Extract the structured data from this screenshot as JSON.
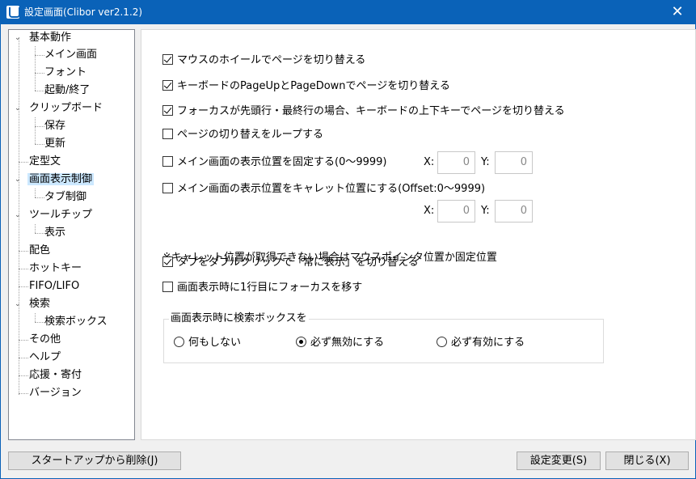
{
  "window": {
    "title": "設定画面(Clibor ver2.1.2)",
    "close_glyph": "✕"
  },
  "tree": {
    "expander": "⌄",
    "items": [
      {
        "label": "基本動作"
      },
      {
        "label": "メイン画面"
      },
      {
        "label": "フォント"
      },
      {
        "label": "起動/終了"
      },
      {
        "label": "クリップボード"
      },
      {
        "label": "保存"
      },
      {
        "label": "更新"
      },
      {
        "label": "定型文"
      },
      {
        "label": "画面表示制御"
      },
      {
        "label": "タブ制御"
      },
      {
        "label": "ツールチップ"
      },
      {
        "label": "表示"
      },
      {
        "label": "配色"
      },
      {
        "label": "ホットキー"
      },
      {
        "label": "FIFO/LIFO"
      },
      {
        "label": "検索"
      },
      {
        "label": "検索ボックス"
      },
      {
        "label": "その他"
      },
      {
        "label": "ヘルプ"
      },
      {
        "label": "応援・寄付"
      },
      {
        "label": "バージョン"
      }
    ]
  },
  "options": [
    {
      "label": "マウスのホイールでページを切り替える",
      "checked": true
    },
    {
      "label": "キーボードのPageUpとPageDownでページを切り替える",
      "checked": true
    },
    {
      "label": "フォーカスが先頭行・最終行の場合、キーボードの上下キーでページを切り替える",
      "checked": true
    },
    {
      "label": "ページの切り替えをループする",
      "checked": false
    },
    {
      "label": "メイン画面の表示位置を固定する(0～9999)",
      "checked": false
    },
    {
      "label": "メイン画面の表示位置をキャレット位置にする(Offset:0～9999)",
      "checked": false
    },
    {
      "label": "タブをダブルクリックで「常に表示」を切り替える",
      "checked": true
    },
    {
      "label": "画面表示時に1行目にフォーカスを移す",
      "checked": false
    }
  ],
  "fixed_position": {
    "x_label": "X:",
    "x_value": "0",
    "y_label": "Y:",
    "y_value": "0"
  },
  "caret_offset": {
    "x_label": "X:",
    "x_value": "0",
    "y_label": "Y:",
    "y_value": "0"
  },
  "note": "※キャレット位置が取得できない場合はマウスポインタ位置か固定位置",
  "search_group": {
    "legend": "画面表示時に検索ボックスを",
    "options": [
      {
        "label": "何もしない",
        "selected": false
      },
      {
        "label": "必ず無効にする",
        "selected": true
      },
      {
        "label": "必ず有効にする",
        "selected": false
      }
    ]
  },
  "buttons": {
    "startup_remove": "スタートアップから削除(J)",
    "apply": "設定変更(S)",
    "close": "閉じる(X)"
  }
}
